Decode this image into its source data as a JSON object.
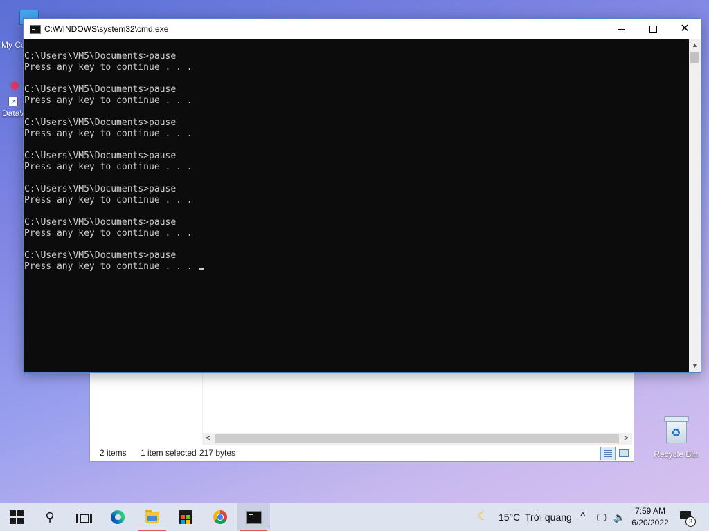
{
  "desktop": {
    "icons": [
      {
        "label": "My Co"
      },
      {
        "label": "DataW"
      },
      {
        "label": "Recycle Bin"
      }
    ]
  },
  "explorer": {
    "status": {
      "items": "2 items",
      "selected": "1 item selected",
      "size": "217 bytes"
    }
  },
  "cmd": {
    "title": "C:\\WINDOWS\\system32\\cmd.exe",
    "output": "C:\\Users\\VM5\\Documents>pause\nPress any key to continue . . .\n\nC:\\Users\\VM5\\Documents>pause\nPress any key to continue . . .\n\nC:\\Users\\VM5\\Documents>pause\nPress any key to continue . . .\n\nC:\\Users\\VM5\\Documents>pause\nPress any key to continue . . .\n\nC:\\Users\\VM5\\Documents>pause\nPress any key to continue . . .\n\nC:\\Users\\VM5\\Documents>pause\nPress any key to continue . . .\n\nC:\\Users\\VM5\\Documents>pause\nPress any key to continue . . ."
  },
  "taskbar": {
    "apps": [
      "start-icon",
      "search-icon",
      "task-view-icon",
      "edge-icon",
      "file-explorer-icon",
      "store-icon",
      "chrome-icon",
      "cmd-icon"
    ],
    "weather": {
      "temperature": "15°C",
      "condition": "Trời quang"
    },
    "clock": {
      "time": "7:59 AM",
      "date": "6/20/2022"
    },
    "notifications": {
      "count": "3"
    }
  },
  "colors": {
    "console_bg": "#0c0c0c",
    "console_text": "#cccccc",
    "taskbar_bg": "#dde3ef",
    "active_indicator": "#e05a5a"
  }
}
